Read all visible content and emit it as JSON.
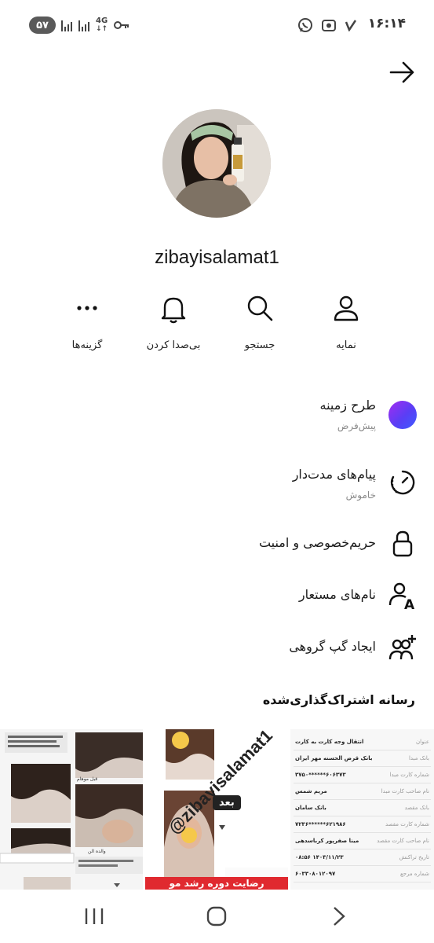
{
  "status_bar": {
    "battery": "۵۷",
    "network": "4G",
    "time": "۱۶:۱۴"
  },
  "profile": {
    "username": "zibayisalamat1"
  },
  "actions": [
    {
      "label": "نمایه",
      "icon": "person-icon"
    },
    {
      "label": "جستجو",
      "icon": "search-icon"
    },
    {
      "label": "بی‌صدا کردن",
      "icon": "bell-icon"
    },
    {
      "label": "گزینه‌ها",
      "icon": "more-dots-icon"
    }
  ],
  "menu": {
    "theme": {
      "title": "طرح زمینه",
      "subtitle": "پیش‌فرض"
    },
    "disappearing": {
      "title": "پیام‌های مدت‌دار",
      "subtitle": "خاموش"
    },
    "privacy": {
      "title": "حریم‌خصوصی و امنیت"
    },
    "nicknames": {
      "title": "نام‌های مستعار"
    },
    "group_chat": {
      "title": "ایجاد گپ گروهی"
    }
  },
  "shared_media": {
    "title": "رسانه اشتراک‌گذاری‌شده",
    "tile2_watermark": "@zibayisalamat1",
    "tile2_badge": "بعد",
    "tile2_banner": "رضایت دوره رشد مو",
    "tile1_caption_before": "قبل موهام",
    "tile1_caption_after": "والده الن",
    "tile3_rows": [
      {
        "label": "عنوان",
        "value": "انتقال وجه کارت به کارت"
      },
      {
        "label": "بانک مبدا",
        "value": "بانک قرض الحسنه مهر ایران"
      },
      {
        "label": "شماره کارت مبدا",
        "value": "۶۰۶۳۷۳******۳۷۵۰"
      },
      {
        "label": "نام صاحب کارت مبدا",
        "value": "مریم شمس"
      },
      {
        "label": "بانک مقصد",
        "value": "بانک سامان"
      },
      {
        "label": "شماره کارت مقصد",
        "value": "۶۲۱۹۸۶******۷۲۳۶"
      },
      {
        "label": "نام صاحب کارت مقصد",
        "value": "مینا صفرپور کرباسدهی"
      },
      {
        "label": "تاریخ تراکنش",
        "value": "۱۴۰۳/۱۱/۲۳ ۰۸:۵۶"
      },
      {
        "label": "شماره مرجع",
        "value": "۶۰۳۳۰۸۰۱۲۰۹۷"
      }
    ]
  },
  "colors": {
    "theme_gradient_start": "#a32cf0",
    "theme_gradient_end": "#3d5cff",
    "banner_red": "#e0292f"
  }
}
